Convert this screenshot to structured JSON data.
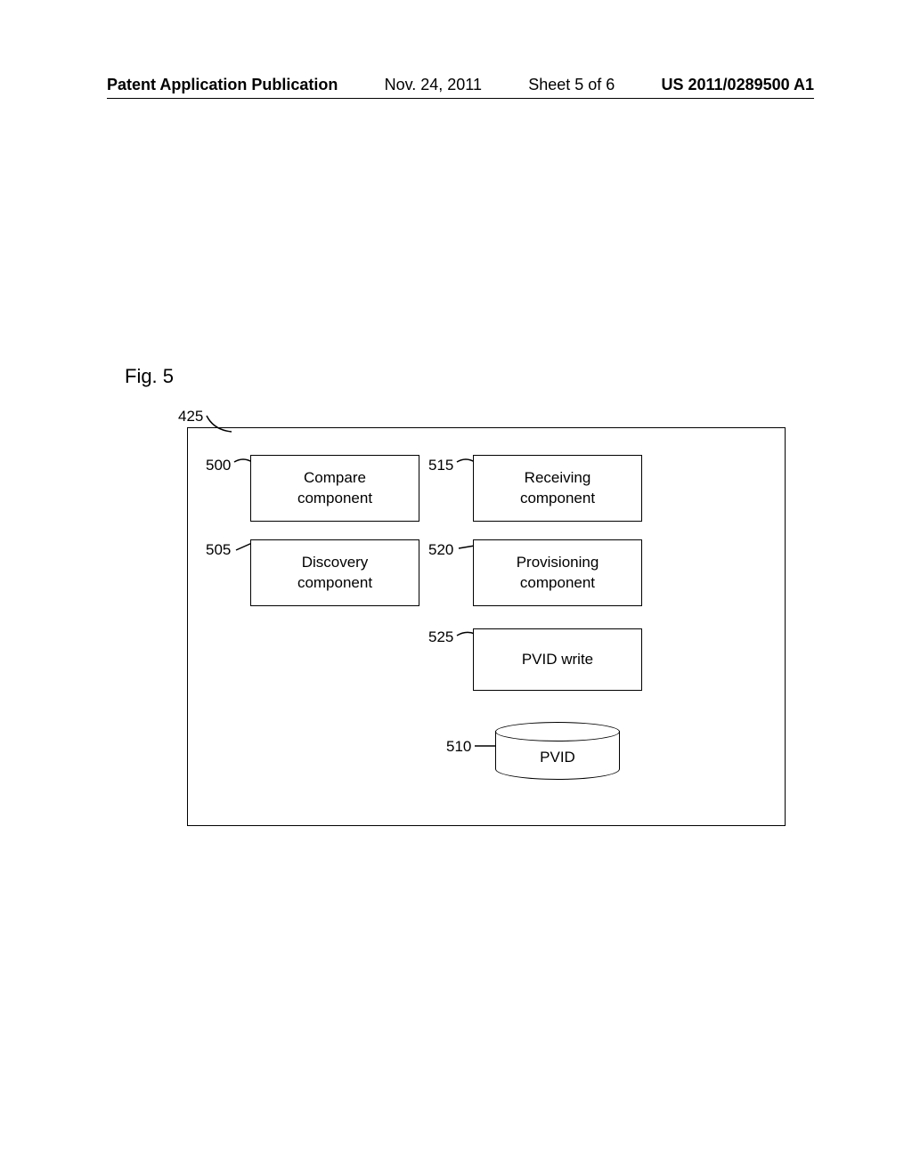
{
  "header": {
    "title": "Patent Application Publication",
    "date": "Nov. 24, 2011",
    "sheet": "Sheet 5 of 6",
    "pubnum": "US 2011/0289500 A1"
  },
  "figure": {
    "caption": "Fig. 5",
    "outer_ref": "425"
  },
  "boxes": {
    "compare": {
      "ref": "500",
      "label": "Compare\ncomponent"
    },
    "discovery": {
      "ref": "505",
      "label": "Discovery\ncomponent"
    },
    "receiving": {
      "ref": "515",
      "label": "Receiving\ncomponent"
    },
    "provisioning": {
      "ref": "520",
      "label": "Provisioning\ncomponent"
    },
    "pvidwrite": {
      "ref": "525",
      "label": "PVID write"
    },
    "pvid": {
      "ref": "510",
      "label": "PVID"
    }
  }
}
